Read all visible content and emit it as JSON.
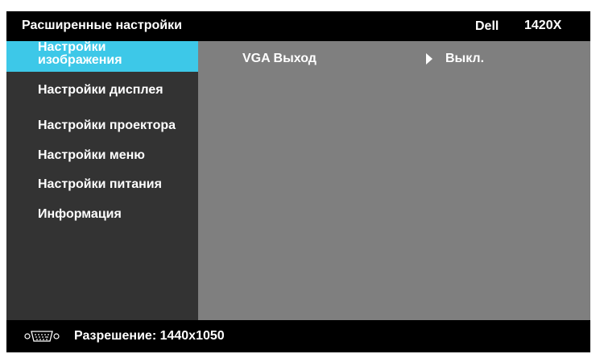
{
  "header": {
    "title": "Расширенные настройки",
    "brand": "Dell",
    "model": "1420X"
  },
  "sidebar": {
    "items": [
      {
        "label": "Настройки изображения",
        "active": true
      },
      {
        "label": "Настройки дисплея",
        "active": false
      },
      {
        "label": "Настройки проектора",
        "active": false
      },
      {
        "label": "Настройки меню",
        "active": false
      },
      {
        "label": "Настройки питания",
        "active": false
      },
      {
        "label": "Информация",
        "active": false
      }
    ]
  },
  "content": {
    "setting_name": "VGA Выход",
    "setting_value": "Выкл."
  },
  "footer": {
    "icon": "vga-port-icon",
    "resolution_text": "Разрешение: 1440x1050"
  },
  "colors": {
    "highlight": "#3dc8e8",
    "sidebar_bg": "#333333",
    "content_bg": "#7f7f7f",
    "bar_bg": "#000000"
  }
}
